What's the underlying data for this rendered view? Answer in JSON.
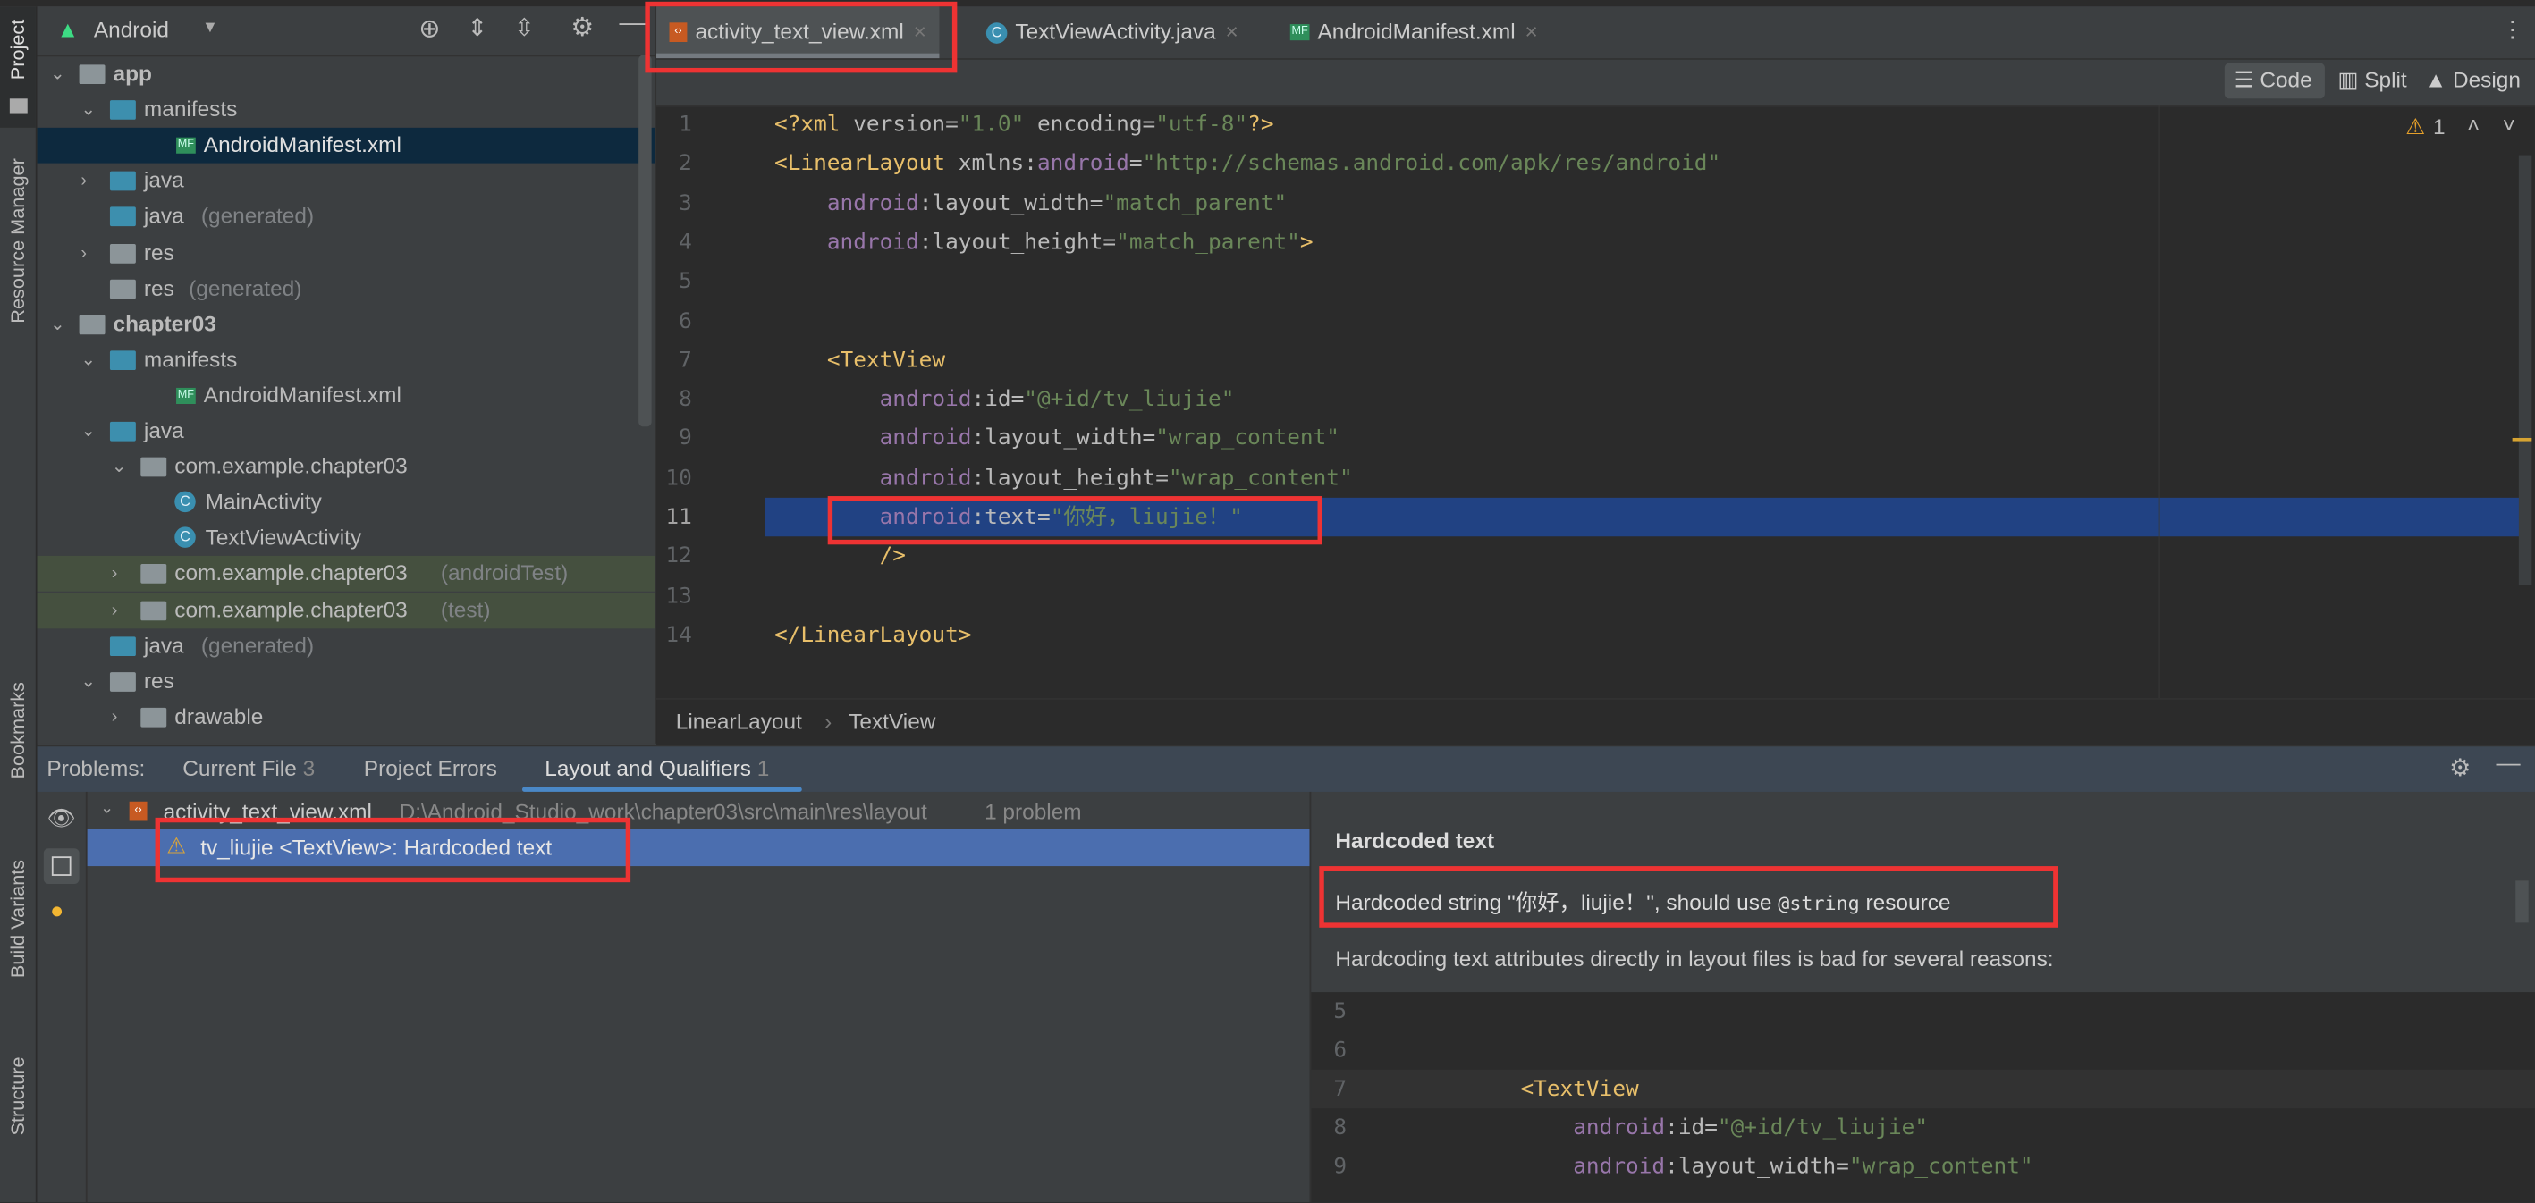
{
  "left_strip": {
    "project": "Project",
    "resource_manager": "Resource Manager",
    "bookmarks": "Bookmarks",
    "build_variants": "Build Variants",
    "structure": "Structure"
  },
  "project_panel": {
    "view_selector": "Android",
    "tree": [
      {
        "label": "app",
        "suffix": "",
        "bold": true,
        "depth": 0,
        "expanded": true,
        "icon": "module-folder-icon"
      },
      {
        "label": "manifests",
        "suffix": "",
        "depth": 1,
        "expanded": true,
        "icon": "folder-icon"
      },
      {
        "label": "AndroidManifest.xml",
        "suffix": "",
        "depth": 2,
        "icon": "manifest-file-icon",
        "selected": true
      },
      {
        "label": "java",
        "suffix": "",
        "depth": 1,
        "expanded": false,
        "icon": "folder-icon"
      },
      {
        "label": "java",
        "suffix": "(generated)",
        "depth": 1,
        "icon": "generated-folder-icon"
      },
      {
        "label": "res",
        "suffix": "",
        "depth": 1,
        "expanded": false,
        "icon": "res-folder-icon"
      },
      {
        "label": "res",
        "suffix": "(generated)",
        "depth": 1,
        "icon": "res-folder-icon"
      },
      {
        "label": "chapter03",
        "suffix": "",
        "bold": true,
        "depth": 0,
        "expanded": true,
        "icon": "module-folder-icon"
      },
      {
        "label": "manifests",
        "suffix": "",
        "depth": 1,
        "expanded": true,
        "icon": "folder-icon"
      },
      {
        "label": "AndroidManifest.xml",
        "suffix": "",
        "depth": 2,
        "icon": "manifest-file-icon"
      },
      {
        "label": "java",
        "suffix": "",
        "depth": 1,
        "expanded": true,
        "icon": "folder-icon"
      },
      {
        "label": "com.example.chapter03",
        "suffix": "",
        "depth": 2,
        "expanded": true,
        "icon": "package-icon"
      },
      {
        "label": "MainActivity",
        "suffix": "",
        "depth": 3,
        "icon": "class-icon"
      },
      {
        "label": "TextViewActivity",
        "suffix": "",
        "depth": 3,
        "icon": "class-icon"
      },
      {
        "label": "com.example.chapter03",
        "suffix": "(androidTest)",
        "depth": 2,
        "expanded": false,
        "icon": "package-icon",
        "tinted": true
      },
      {
        "label": "com.example.chapter03",
        "suffix": "(test)",
        "depth": 2,
        "expanded": false,
        "icon": "package-icon",
        "tinted": true
      },
      {
        "label": "java",
        "suffix": "(generated)",
        "depth": 1,
        "icon": "generated-folder-icon"
      },
      {
        "label": "res",
        "suffix": "",
        "depth": 1,
        "expanded": true,
        "icon": "res-folder-icon"
      },
      {
        "label": "drawable",
        "suffix": "",
        "depth": 2,
        "expanded": false,
        "icon": "package-icon"
      }
    ]
  },
  "editor": {
    "tabs": [
      {
        "label": "activity_text_view.xml",
        "icon": "xml",
        "active": true
      },
      {
        "label": "TextViewActivity.java",
        "icon": "class"
      },
      {
        "label": "AndroidManifest.xml",
        "icon": "manifest"
      }
    ],
    "view_modes": [
      "Code",
      "Split",
      "Design"
    ],
    "warning_count": "1",
    "current_line": 11,
    "lines": [
      {
        "n": "1",
        "parts": [
          [
            "tag",
            "<?xml "
          ],
          [
            "attr",
            "version="
          ],
          [
            "str",
            "\"1.0\""
          ],
          [
            "attr",
            " encoding="
          ],
          [
            "str",
            "\"utf-8\""
          ],
          [
            "tag",
            "?>"
          ]
        ]
      },
      {
        "n": "2",
        "parts": [
          [
            "tag",
            "<LinearLayout "
          ],
          [
            "attr",
            "xmlns:"
          ],
          [
            "ns",
            "android"
          ],
          [
            "attr",
            "="
          ],
          [
            "str",
            "\"http://schemas.android.com/apk/res/android\""
          ]
        ]
      },
      {
        "n": "3",
        "parts": [
          [
            "attr",
            "    "
          ],
          [
            "ns",
            "android"
          ],
          [
            "attr",
            ":layout_width="
          ],
          [
            "str",
            "\"match_parent\""
          ]
        ]
      },
      {
        "n": "4",
        "parts": [
          [
            "attr",
            "    "
          ],
          [
            "ns",
            "android"
          ],
          [
            "attr",
            ":layout_height="
          ],
          [
            "str",
            "\"match_parent\""
          ],
          [
            "tag",
            ">"
          ]
        ]
      },
      {
        "n": "5",
        "parts": []
      },
      {
        "n": "6",
        "parts": []
      },
      {
        "n": "7",
        "parts": [
          [
            "attr",
            "    "
          ],
          [
            "tag",
            "<TextView"
          ]
        ]
      },
      {
        "n": "8",
        "parts": [
          [
            "attr",
            "        "
          ],
          [
            "ns",
            "android"
          ],
          [
            "attr",
            ":id="
          ],
          [
            "str",
            "\"@+id/tv_liujie\""
          ]
        ]
      },
      {
        "n": "9",
        "parts": [
          [
            "attr",
            "        "
          ],
          [
            "ns",
            "android"
          ],
          [
            "attr",
            ":layout_width="
          ],
          [
            "str",
            "\"wrap_content\""
          ]
        ]
      },
      {
        "n": "10",
        "parts": [
          [
            "attr",
            "        "
          ],
          [
            "ns",
            "android"
          ],
          [
            "attr",
            ":layout_height="
          ],
          [
            "str",
            "\"wrap_content\""
          ]
        ]
      },
      {
        "n": "11",
        "parts": [
          [
            "attr",
            "        "
          ],
          [
            "ns",
            "android"
          ],
          [
            "attr",
            ":text="
          ],
          [
            "str",
            "\"你好，liujie！\""
          ]
        ]
      },
      {
        "n": "12",
        "parts": [
          [
            "attr",
            "        "
          ],
          [
            "tag",
            "/>"
          ]
        ]
      },
      {
        "n": "13",
        "parts": []
      },
      {
        "n": "14",
        "parts": [
          [
            "tag",
            "</LinearLayout>"
          ]
        ]
      }
    ],
    "breadcrumb": [
      "LinearLayout",
      "TextView"
    ]
  },
  "problems": {
    "label": "Problems:",
    "tabs": [
      {
        "label": "Current File",
        "count": "3"
      },
      {
        "label": "Project Errors",
        "count": ""
      },
      {
        "label": "Layout and Qualifiers",
        "count": "1",
        "active": true
      }
    ],
    "file": {
      "name": "activity_text_view.xml",
      "path": "D:\\Android_Studio_work\\chapter03\\src\\main\\res\\layout",
      "count": "1 problem"
    },
    "item": "tv_liujie <TextView>: Hardcoded text",
    "detail": {
      "title": "Hardcoded text",
      "message_pre": "Hardcoded string \"你好，liujie！\", should use ",
      "message_code": "@string",
      "message_post": " resource",
      "explanation": "Hardcoding text attributes directly in layout files is bad for several reasons:",
      "snippet": [
        {
          "n": "5",
          "parts": []
        },
        {
          "n": "6",
          "parts": []
        },
        {
          "n": "7",
          "parts": [
            [
              "attr",
              "    "
            ],
            [
              "tag",
              "<TextView"
            ]
          ]
        },
        {
          "n": "8",
          "parts": [
            [
              "attr",
              "        "
            ],
            [
              "ns",
              "android"
            ],
            [
              "attr",
              ":id="
            ],
            [
              "str",
              "\"@+id/tv_liujie\""
            ]
          ]
        },
        {
          "n": "9",
          "parts": [
            [
              "attr",
              "        "
            ],
            [
              "ns",
              "android"
            ],
            [
              "attr",
              ":layout_width="
            ],
            [
              "str",
              "\"wrap_content\""
            ]
          ]
        }
      ]
    }
  },
  "colors": {
    "accent": "#4a88c7",
    "selection": "#214283",
    "highlight_row": "#4b6eaf",
    "annotation": "#ee3333",
    "warning": "#e5a02a"
  }
}
